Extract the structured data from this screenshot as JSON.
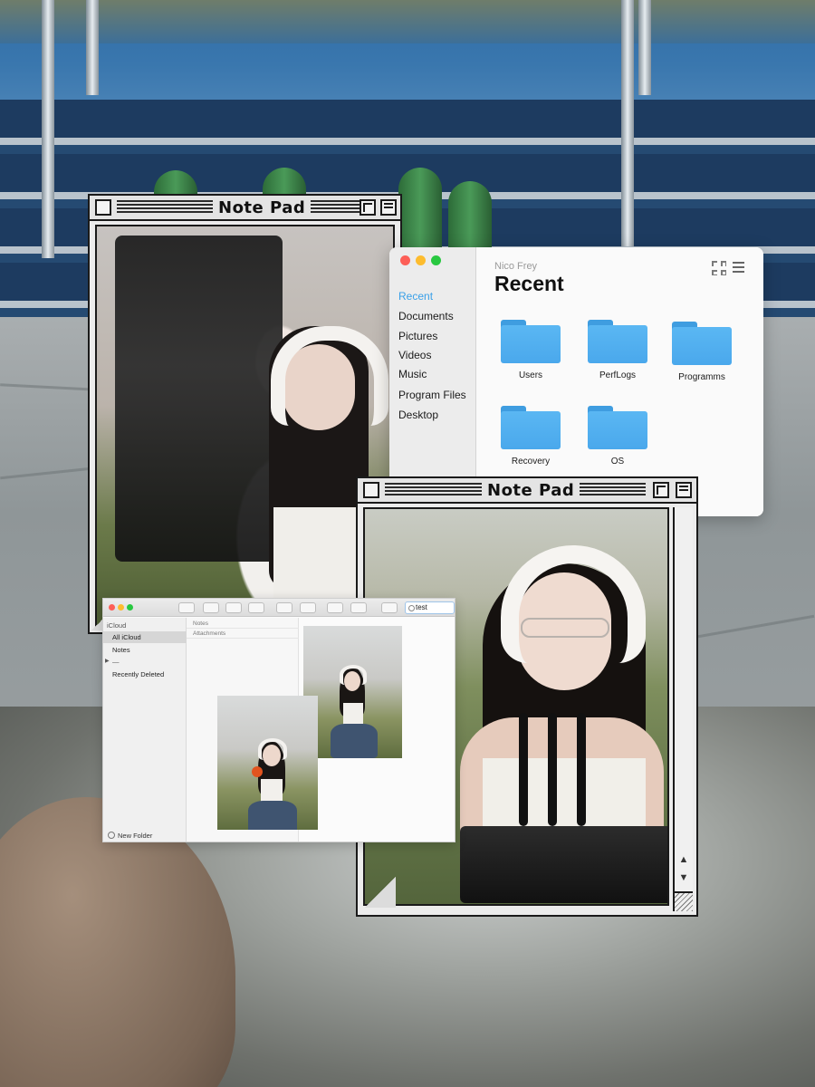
{
  "finder": {
    "user": "Nico Frey",
    "title": "Recent",
    "sidebar": [
      "Recent",
      "Documents",
      "Pictures",
      "Videos",
      "Music",
      "Program Files",
      "Desktop"
    ],
    "active_item": "Recent",
    "folders": [
      "Users",
      "PerfLogs",
      "Programms",
      "Recovery",
      "OS"
    ],
    "accent": "#3aa0e8",
    "folder_color": "#4aa8ec",
    "icons": [
      "grid-view-icon",
      "list-view-icon"
    ]
  },
  "notepad_back": {
    "title": "Note Pad"
  },
  "notepad_front": {
    "title": "Note Pad"
  },
  "notes": {
    "section_header": "iCloud",
    "sidebar": [
      "All iCloud",
      "Notes",
      "—",
      "Recently Deleted"
    ],
    "list_headers": [
      "Notes",
      "Attachments"
    ],
    "search_value": "test",
    "new_folder_label": "New Folder"
  },
  "traffic_lights": {
    "close": "#fd5f57",
    "minimize": "#fdbc2e",
    "zoom": "#28c840"
  }
}
